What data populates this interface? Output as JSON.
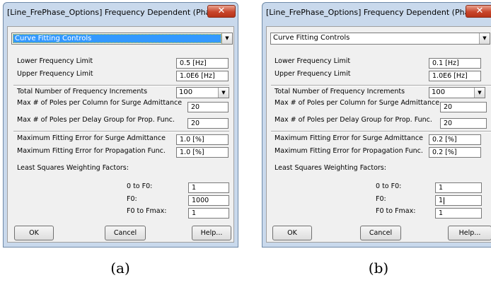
{
  "dialog_a": {
    "title": "[Line_FrePhase_Options] Frequency Dependent (Phase) ...",
    "close_glyph": "✕",
    "section_select": "Curve Fitting Controls",
    "lower_freq_label": "Lower Frequency Limit",
    "lower_freq_value": "0.5 [Hz]",
    "upper_freq_label": "Upper Frequency Limit",
    "upper_freq_value": "1.0E6 [Hz]",
    "increments_label": "Total Number of Frequency Increments",
    "increments_value": "100",
    "poles_col_label": "Max # of Poles per Column for Surge Admittance",
    "poles_col_value": "20",
    "poles_delay_label": "Max # of Poles per Delay Group for Prop. Func.",
    "poles_delay_value": "20",
    "err_surge_label": "Maximum Fitting Error for Surge Admittance",
    "err_surge_value": "1.0 [%]",
    "err_prop_label": "Maximum Fitting Error for Propagation Func.",
    "err_prop_value": "1.0 [%]",
    "lsw_label": "Least Squares Weighting Factors:",
    "w0_label": "0 to F0:",
    "w0_value": "1",
    "wf0_label": "F0:",
    "wf0_value": "1000",
    "wmax_label": "F0 to Fmax:",
    "wmax_value": "1",
    "ok": "OK",
    "cancel": "Cancel",
    "help": "Help..."
  },
  "dialog_b": {
    "title": "[Line_FrePhase_Options] Frequency Dependent (Phase) ...",
    "close_glyph": "✕",
    "section_select": "Curve Fitting Controls",
    "lower_freq_label": "Lower Frequency Limit",
    "lower_freq_value": "0.1 [Hz]",
    "upper_freq_label": "Upper Frequency Limit",
    "upper_freq_value": "1.0E6 [Hz]",
    "increments_label": "Total Number of Frequency Increments",
    "increments_value": "100",
    "poles_col_label": "Max # of Poles per Column for Surge Admittance",
    "poles_col_value": "20",
    "poles_delay_label": "Max # of Poles per Delay Group for Prop. Func.",
    "poles_delay_value": "20",
    "err_surge_label": "Maximum Fitting Error for Surge Admittance",
    "err_surge_value": "0.2 [%]",
    "err_prop_label": "Maximum Fitting Error for Propagation Func.",
    "err_prop_value": "0.2 [%]",
    "lsw_label": "Least Squares Weighting Factors:",
    "w0_label": "0 to F0:",
    "w0_value": "1",
    "wf0_label": "F0:",
    "wf0_value": "1",
    "wmax_label": "F0 to Fmax:",
    "wmax_value": "1",
    "ok": "OK",
    "cancel": "Cancel",
    "help": "Help..."
  },
  "captions": {
    "a": "(a)",
    "b": "(b)"
  }
}
